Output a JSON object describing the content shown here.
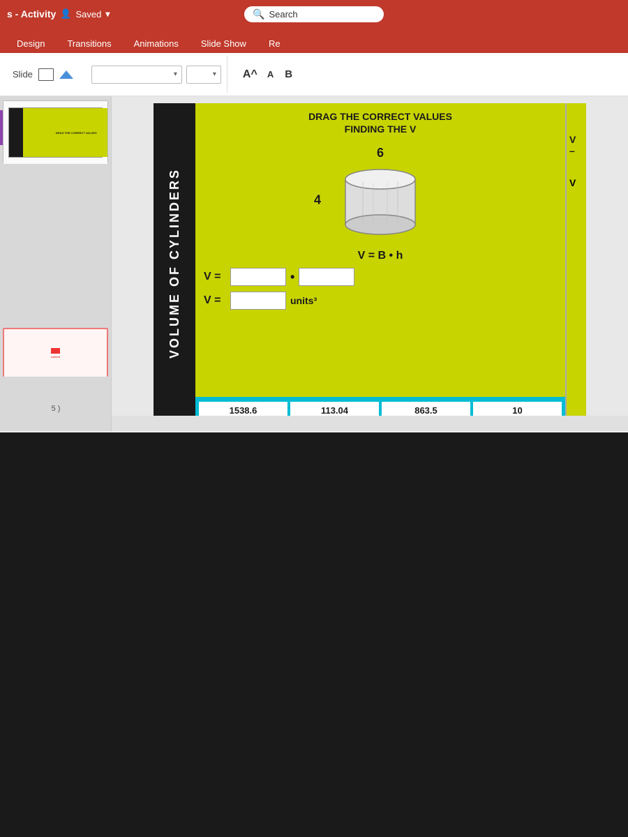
{
  "titlebar": {
    "title": "s - Activity",
    "saved_label": "Saved",
    "dropdown_icon": "▾",
    "search_placeholder": "Search"
  },
  "ribbon": {
    "tabs": [
      {
        "label": "Design"
      },
      {
        "label": "Transitions"
      },
      {
        "label": "Animations"
      },
      {
        "label": "Slide Show"
      },
      {
        "label": "Re"
      }
    ]
  },
  "toolbar": {
    "font_placeholder": "",
    "font_size_up": "A^",
    "font_size_down": "A",
    "bold": "B",
    "slide_label": "Slide"
  },
  "slide": {
    "vertical_banner_text": "VOLUME OF CYLINDERS",
    "heading_line1": "DRAG THE CORRECT VALUES",
    "heading_line2": "FINDING THE V",
    "dimension_top": "6",
    "dimension_side": "4",
    "formula": "V = B • h",
    "input_row1_label": "V =",
    "input_row1_dot": "•",
    "input_row2_label": "V =",
    "input_row2_units": "units³",
    "answer_tiles": [
      {
        "value": "1538.6"
      },
      {
        "value": "113.04"
      },
      {
        "value": "863.5"
      },
      {
        "value": "10"
      }
    ]
  },
  "status": {
    "slide_number": "5 )"
  }
}
